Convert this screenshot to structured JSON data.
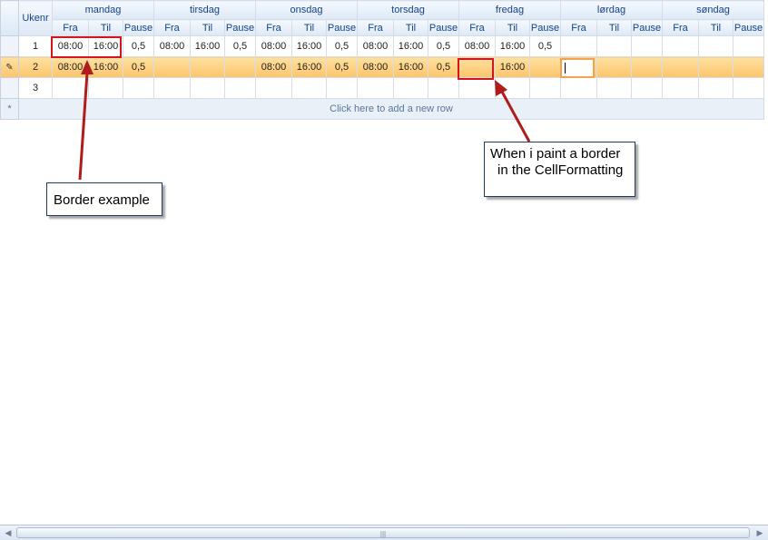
{
  "header": {
    "ukenr": "Ukenr",
    "days": [
      "mandag",
      "tirsdag",
      "onsdag",
      "torsdag",
      "fredag",
      "lørdag",
      "søndag"
    ],
    "sub": [
      "Fra",
      "Til",
      "Pause"
    ]
  },
  "rows": [
    {
      "num": "1",
      "cells": [
        "08:00",
        "16:00",
        "0,5",
        "08:00",
        "16:00",
        "0,5",
        "08:00",
        "16:00",
        "0,5",
        "08:00",
        "16:00",
        "0,5",
        "08:00",
        "16:00",
        "0,5",
        "",
        "",
        "",
        "",
        "",
        ""
      ]
    },
    {
      "num": "2",
      "cells": [
        "08:00",
        "16:00",
        "0,5",
        "",
        "",
        "",
        "08:00",
        "16:00",
        "0,5",
        "08:00",
        "16:00",
        "0,5",
        "",
        "16:00",
        "",
        "",
        "",
        "",
        "",
        "",
        ""
      ]
    },
    {
      "num": "3",
      "cells": [
        "",
        "",
        "",
        "",
        "",
        "",
        "",
        "",
        "",
        "",
        "",
        "",
        "",
        "",
        "",
        "",
        "",
        "",
        "",
        "",
        ""
      ]
    }
  ],
  "addrow": {
    "label": "Click here to add a new row",
    "marker": "*"
  },
  "edit_marker": "✎",
  "annotations": {
    "border_example": "Border example",
    "paint_line1": "When i paint a border",
    "paint_line2": "in the CellFormatting"
  },
  "colors": {
    "arrow": "#b01c1c",
    "red_border": "#d4151c",
    "edit_border": "#f3a24d"
  }
}
